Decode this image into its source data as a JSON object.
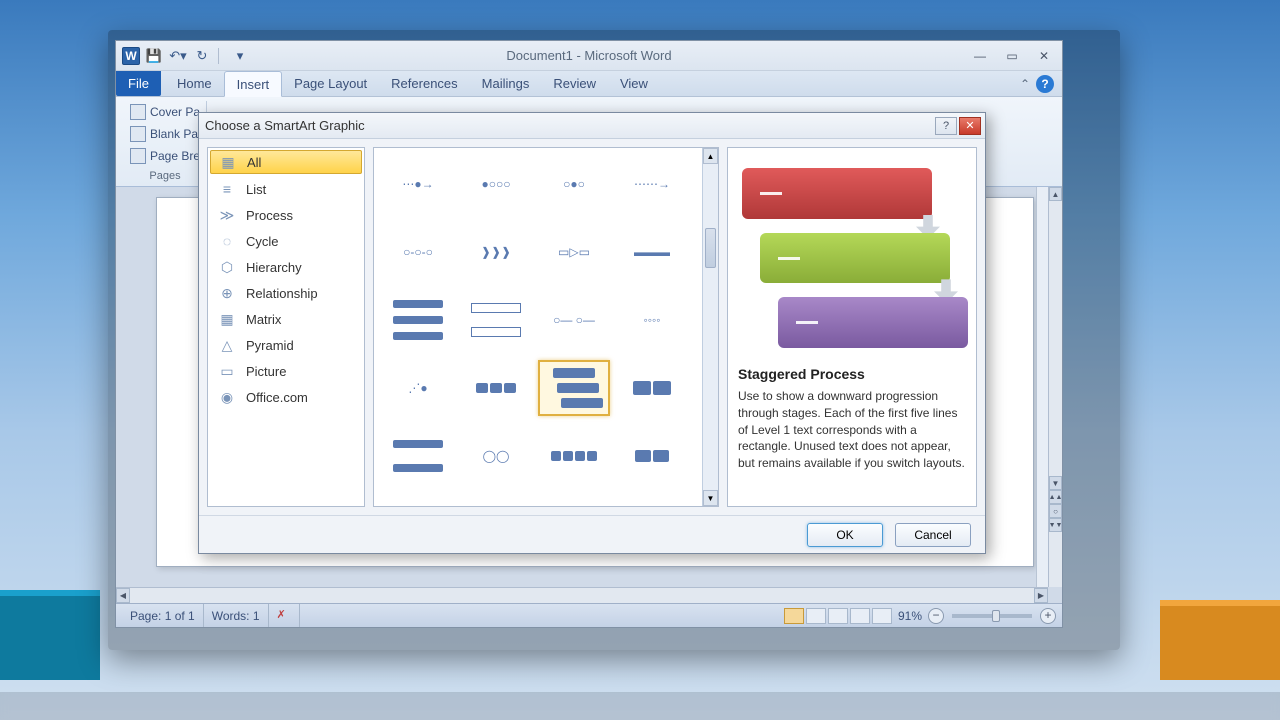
{
  "window": {
    "title": "Document1 - Microsoft Word"
  },
  "ribbon": {
    "tabs": {
      "file": "File",
      "home": "Home",
      "insert": "Insert",
      "page_layout": "Page Layout",
      "references": "References",
      "mailings": "Mailings",
      "review": "Review",
      "view": "View"
    },
    "pages_group": {
      "cover": "Cover Pa",
      "blank": "Blank Pa",
      "break": "Page Bre",
      "label": "Pages"
    }
  },
  "dialog": {
    "title": "Choose a SmartArt Graphic",
    "categories": {
      "all": "All",
      "list": "List",
      "process": "Process",
      "cycle": "Cycle",
      "hierarchy": "Hierarchy",
      "relationship": "Relationship",
      "matrix": "Matrix",
      "pyramid": "Pyramid",
      "picture": "Picture",
      "office": "Office.com"
    },
    "preview": {
      "title": "Staggered Process",
      "desc": "Use to show a downward progression through stages. Each of the first five lines of Level 1 text corresponds with a rectangle. Unused text does not appear, but remains available if you switch layouts."
    },
    "buttons": {
      "ok": "OK",
      "cancel": "Cancel"
    }
  },
  "status": {
    "page": "Page: 1 of 1",
    "words": "Words: 1",
    "zoom": "91%"
  }
}
